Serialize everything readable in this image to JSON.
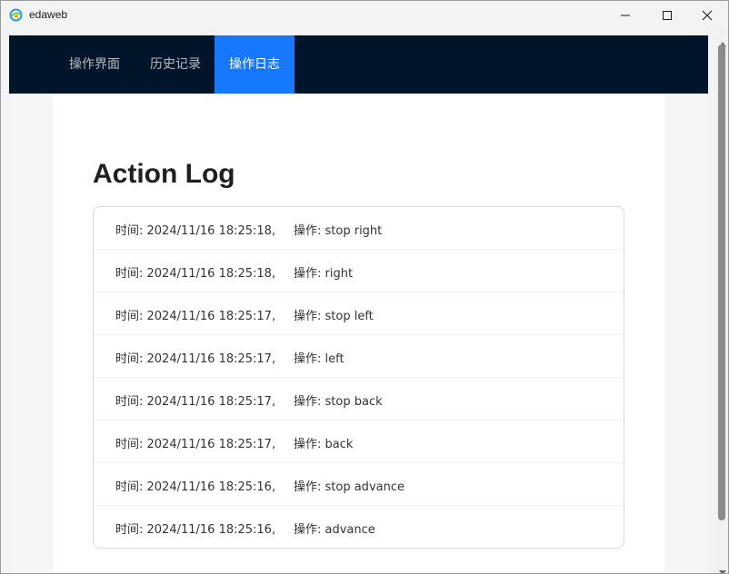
{
  "window": {
    "title": "edaweb"
  },
  "navbar": {
    "items": [
      {
        "label": "操作界面"
      },
      {
        "label": "历史记录"
      },
      {
        "label": "操作日志",
        "active": true
      }
    ]
  },
  "page": {
    "heading": "Action Log"
  },
  "log": {
    "rows": [
      {
        "time": "时间: 2024/11/16 18:25:18,",
        "action": "操作: stop right"
      },
      {
        "time": "时间: 2024/11/16 18:25:18,",
        "action": "操作: right"
      },
      {
        "time": "时间: 2024/11/16 18:25:17,",
        "action": "操作: stop left"
      },
      {
        "time": "时间: 2024/11/16 18:25:17,",
        "action": "操作: left"
      },
      {
        "time": "时间: 2024/11/16 18:25:17,",
        "action": "操作: stop back"
      },
      {
        "time": "时间: 2024/11/16 18:25:17,",
        "action": "操作: back"
      },
      {
        "time": "时间: 2024/11/16 18:25:16,",
        "action": "操作: stop advance"
      },
      {
        "time": "时间: 2024/11/16 18:25:16,",
        "action": "操作: advance"
      }
    ]
  },
  "icons": {
    "app": "edge-logo-icon",
    "minimize": "minimize-icon",
    "maximize": "maximize-icon",
    "close": "close-icon"
  },
  "colors": {
    "nav_bg": "#001529",
    "nav_active": "#1677ff"
  }
}
